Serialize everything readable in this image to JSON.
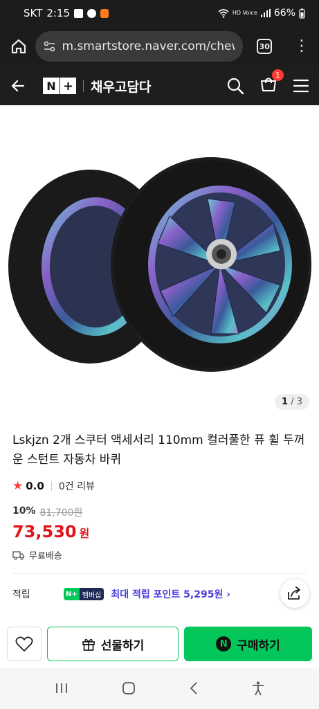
{
  "status": {
    "carrier": "SKT",
    "time": "2:15",
    "network": "HD Voice",
    "battery": "66%"
  },
  "browser": {
    "url": "m.smartstore.naver.com/chewoo",
    "tab_count": "30"
  },
  "store": {
    "name": "채우고담다",
    "cart_count": "1"
  },
  "gallery": {
    "current": "1",
    "total": "3"
  },
  "product": {
    "title": "Lskjzn 2개 스쿠터 액세서리 110mm 컬러풀한 퓨 휠 두꺼운 스턴트 자동차 바퀴",
    "rating": "0.0",
    "reviews": "0건 리뷰",
    "discount": "10%",
    "original_price": "81,700원",
    "price": "73,530",
    "currency": "원",
    "shipping": "무료배송"
  },
  "points": {
    "label": "적립",
    "badge_n": "N",
    "badge_text": "멤버십",
    "link": "최대 적립 포인트 5,295원"
  },
  "actions": {
    "gift": "선물하기",
    "buy": "구매하기",
    "npay": "N"
  },
  "colors": {
    "accent": "#03c75a",
    "price": "#e0151e",
    "points": "#4a3de0"
  }
}
